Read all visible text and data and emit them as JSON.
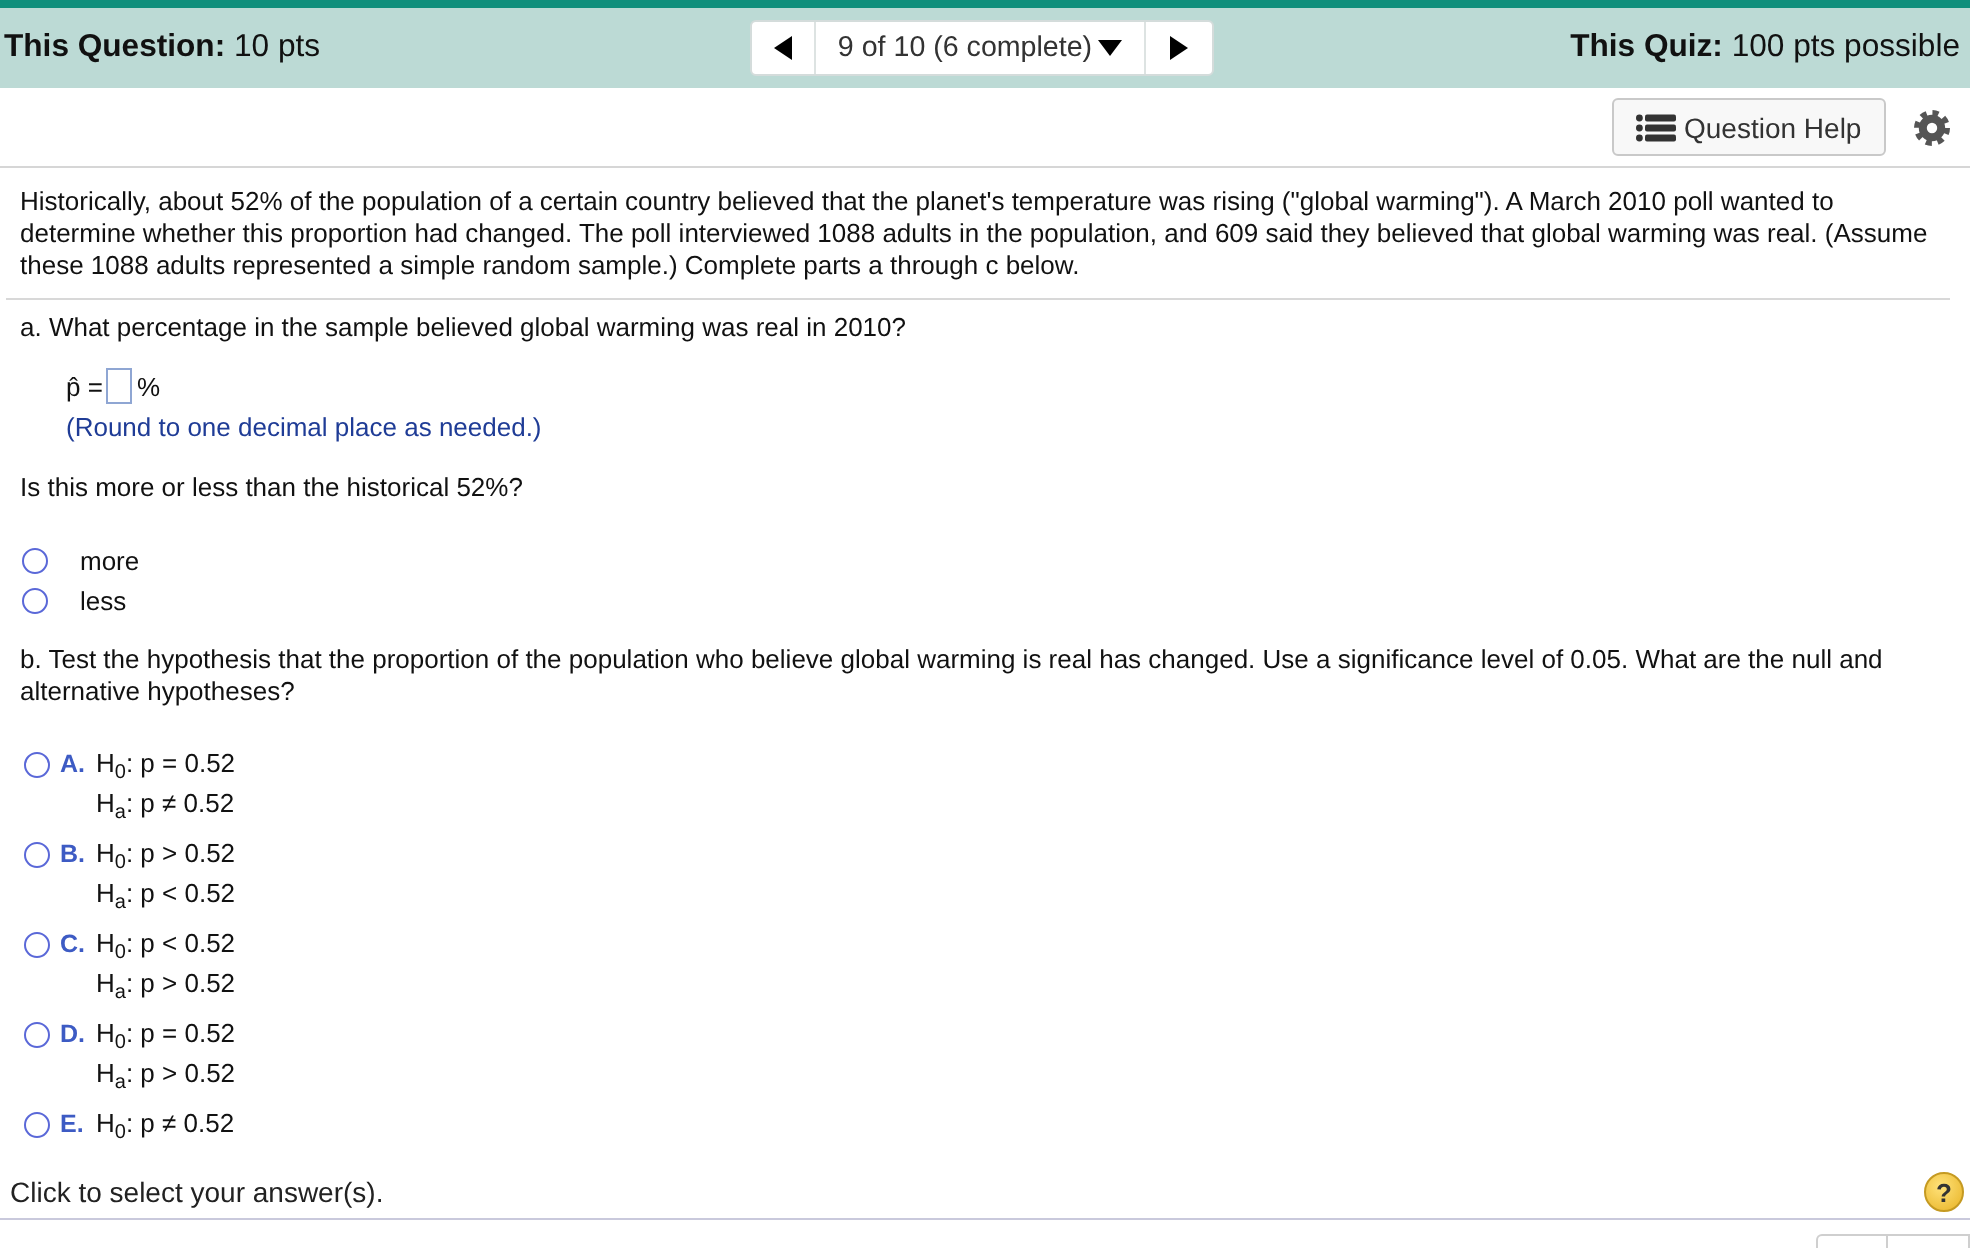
{
  "header": {
    "question_points": "**This Question:** 10 pts",
    "navigator": {
      "position": "9 of 10 (6 complete)"
    },
    "quiz_points": "**This Quiz:** 100 pts possible"
  },
  "toolbar": {
    "help_button": "Question Help"
  },
  "intro": "Historically, about 52% of the population of a certain country believed that the planet's temperature was rising (\"global warming\"). A March 2010 poll wanted to determine whether this proportion had changed. The poll interviewed 1088 adults in the population, and 609 said they believed that global warming was real. (Assume these 1088 adults represented a simple random sample.) Complete parts a through c below.",
  "part_a": {
    "prompt": "a. What percentage in the sample believed global warming was real in 2010?",
    "answer": {
      "label": "p̂ =",
      "unit": "%"
    },
    "hint": "(Round to one decimal place as needed.)",
    "followup": "Is this more or less than the historical 52%?",
    "options": [
      {
        "label": "more",
        "selected": false
      },
      {
        "label": "less",
        "selected": false
      }
    ]
  },
  "part_b": {
    "prompt": "b. Test the hypothesis that the proportion of the population who believe global warming is real has changed. Use a significance level of 0.05. What are the null and alternative hypotheses?",
    "options": [
      {
        "letter": "A.",
        "lines": [
          "H$_{0}$: p = 0.52",
          "H$_{a}$: p ≠ 0.52"
        ],
        "selected": false
      },
      {
        "letter": "B.",
        "lines": [
          "H$_{0}$: p > 0.52",
          "H$_{a}$: p < 0.52"
        ],
        "selected": false
      },
      {
        "letter": "C.",
        "lines": [
          "H$_{0}$: p < 0.52",
          "H$_{a}$: p > 0.52"
        ],
        "selected": false
      },
      {
        "letter": "D.",
        "lines": [
          "H$_{0}$: p = 0.52",
          "H$_{a}$: p > 0.52"
        ],
        "selected": false
      },
      {
        "letter": "E.",
        "lines": [
          "H$_{0}$: p ≠ 0.52"
        ],
        "selected": false
      }
    ]
  },
  "footer": {
    "instruction": "Click to select your answer(s).",
    "help": "?"
  }
}
